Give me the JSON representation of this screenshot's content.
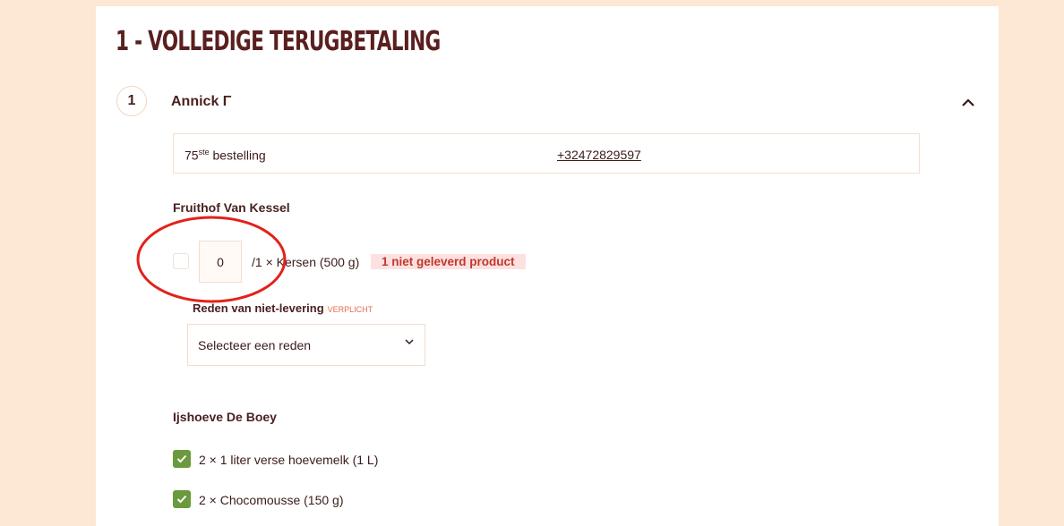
{
  "section": {
    "title": "1 - VOLLEDIGE TERUGBETALING"
  },
  "customer": {
    "step_number": "1",
    "name": "Annick Γ"
  },
  "order_info": {
    "order_number": "75",
    "order_suffix": "ste",
    "order_label": "bestelling",
    "phone": "+32472829597"
  },
  "suppliers": [
    {
      "name": "Fruithof Van Kessel",
      "items": [
        {
          "quantity_value": "0",
          "label": "/1 × Kersen (500 g)",
          "badge": "1 niet geleverd product",
          "reason_label": "Reden van niet-levering",
          "reason_required": "VERPLICHT",
          "reason_placeholder": "Selecteer een reden"
        }
      ]
    },
    {
      "name": "Ijshoeve De Boey",
      "items": [
        {
          "label": "2 × 1 liter verse hoevemelk (1 L)",
          "checked": true
        },
        {
          "label": "2 × Chocomousse (150 g)",
          "checked": true
        }
      ]
    }
  ],
  "colors": {
    "page_bg": "#fde8d3",
    "card_bg": "#ffffff",
    "text_primary": "#4a1f1f",
    "badge_bg": "#fde1e1",
    "badge_text": "#c0392b",
    "checkbox_green": "#6a9a3c",
    "annotation_red": "#e32119",
    "required_orange": "#e36d4a"
  },
  "icons": {
    "collapse": "chevron-up-icon",
    "select": "chevron-down-icon",
    "check": "checkmark-icon"
  }
}
